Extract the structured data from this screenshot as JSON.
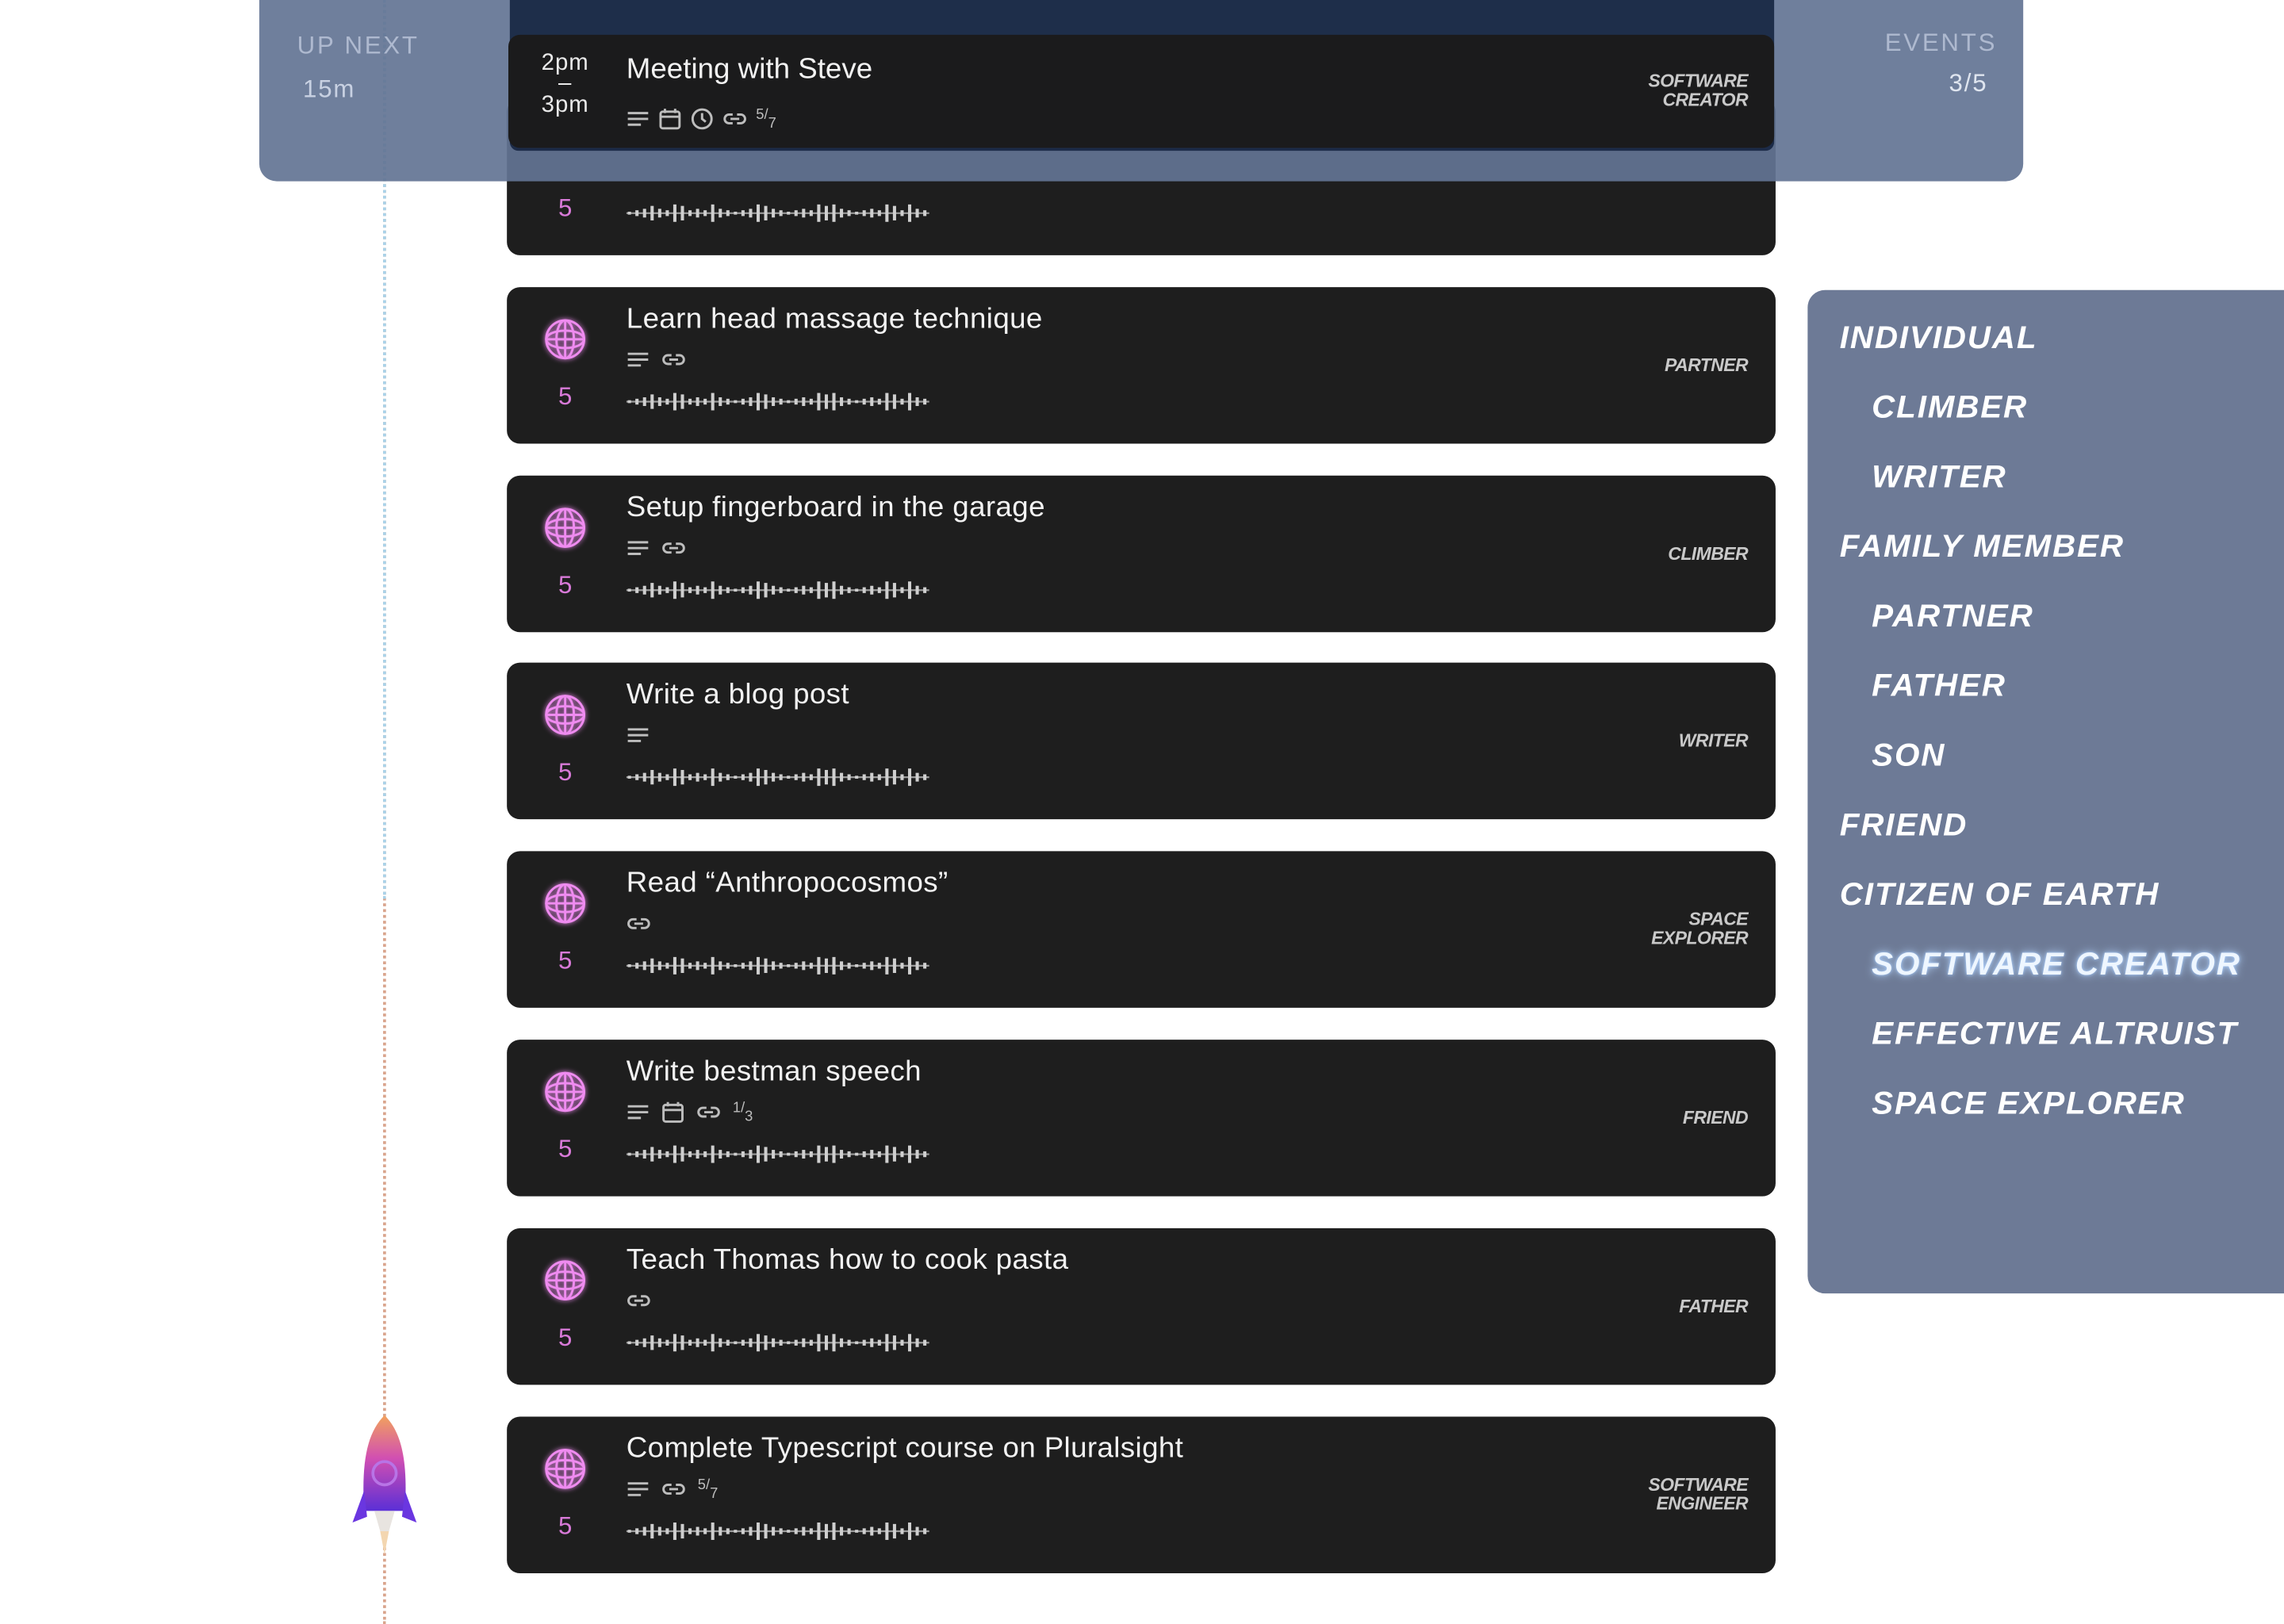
{
  "header": {
    "up_next_label": "UP NEXT",
    "up_next_value": "15m",
    "events_label": "EVENTS",
    "events_value": "3/5"
  },
  "current_event": {
    "time_start": "2pm",
    "time_sep": "–",
    "time_end": "3pm",
    "title": "Meeting with Steve",
    "fraction_num": "5",
    "fraction_den": "7",
    "role_line1": "SOFTWARE",
    "role_line2": "CREATOR"
  },
  "tasks": [
    {
      "title": "Learn head massage technique",
      "score": "5",
      "role_line1": "PARTNER",
      "role_line2": "",
      "icons": [
        "notes-icon",
        "link-icon"
      ],
      "fraction_num": "",
      "fraction_den": ""
    },
    {
      "title": "Setup fingerboard in the garage",
      "score": "5",
      "role_line1": "CLIMBER",
      "role_line2": "",
      "icons": [
        "notes-icon",
        "link-icon"
      ],
      "fraction_num": "",
      "fraction_den": ""
    },
    {
      "title": "Write a blog post",
      "score": "5",
      "role_line1": "WRITER",
      "role_line2": "",
      "icons": [
        "notes-icon"
      ],
      "fraction_num": "",
      "fraction_den": ""
    },
    {
      "title": "Read “Anthropocosmos”",
      "score": "5",
      "role_line1": "SPACE",
      "role_line2": "EXPLORER",
      "icons": [
        "link-icon"
      ],
      "fraction_num": "",
      "fraction_den": ""
    },
    {
      "title": "Write bestman speech",
      "score": "5",
      "role_line1": "FRIEND",
      "role_line2": "",
      "icons": [
        "notes-icon",
        "calendar-icon",
        "link-icon"
      ],
      "fraction_num": "1",
      "fraction_den": "3"
    },
    {
      "title": "Teach Thomas how to cook pasta",
      "score": "5",
      "role_line1": "FATHER",
      "role_line2": "",
      "icons": [
        "link-icon"
      ],
      "fraction_num": "",
      "fraction_den": ""
    },
    {
      "title": "Complete Typescript course on Pluralsight",
      "score": "5",
      "role_line1": "SOFTWARE",
      "role_line2": "ENGINEER",
      "icons": [
        "notes-icon",
        "link-icon"
      ],
      "fraction_num": "5",
      "fraction_den": "7"
    }
  ],
  "hidden_card": {
    "score": "5"
  },
  "roles": [
    {
      "label": "INDIVIDUAL",
      "indent": 0,
      "highlight": false
    },
    {
      "label": "CLIMBER",
      "indent": 1,
      "highlight": false
    },
    {
      "label": "WRITER",
      "indent": 1,
      "highlight": false
    },
    {
      "label": "FAMILY MEMBER",
      "indent": 0,
      "highlight": false
    },
    {
      "label": "PARTNER",
      "indent": 1,
      "highlight": false
    },
    {
      "label": "FATHER",
      "indent": 1,
      "highlight": false
    },
    {
      "label": "SON",
      "indent": 1,
      "highlight": false
    },
    {
      "label": "FRIEND",
      "indent": 0,
      "highlight": false
    },
    {
      "label": "CITIZEN OF EARTH",
      "indent": 0,
      "highlight": false
    },
    {
      "label": "SOFTWARE CREATOR",
      "indent": 1,
      "highlight": true
    },
    {
      "label": "EFFECTIVE ALTRUIST",
      "indent": 1,
      "highlight": false
    },
    {
      "label": "SPACE EXPLORER",
      "indent": 1,
      "highlight": false
    }
  ],
  "colors": {
    "card_bg": "#1e1e1e",
    "score_pink": "#d87ad8",
    "panel_blue": "#6d7a96"
  }
}
